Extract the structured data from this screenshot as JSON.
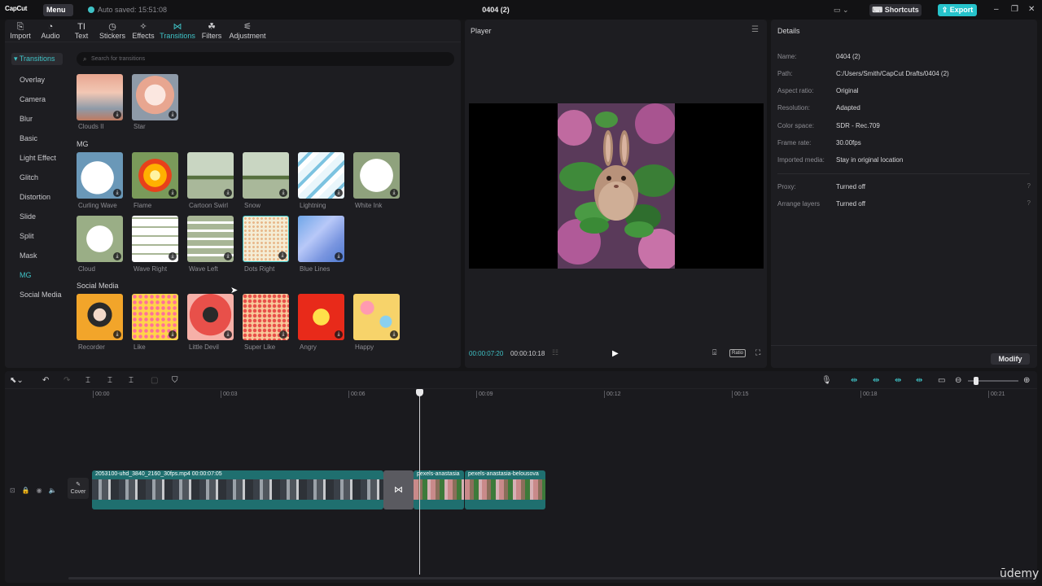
{
  "app": {
    "logo": "CapCut",
    "menu_label": "Menu",
    "autosave": "Auto saved: 15:51:08",
    "project_title": "0404 (2)",
    "shortcuts_label": "Shortcuts",
    "export_label": "Export",
    "accent_color": "#26c3cb"
  },
  "toolbar": {
    "items": [
      {
        "label": "Import",
        "icon": "import-icon"
      },
      {
        "label": "Audio",
        "icon": "audio-icon"
      },
      {
        "label": "Text",
        "icon": "text-icon"
      },
      {
        "label": "Stickers",
        "icon": "sticker-icon"
      },
      {
        "label": "Effects",
        "icon": "effects-icon"
      },
      {
        "label": "Transitions",
        "icon": "transitions-icon",
        "active": true
      },
      {
        "label": "Filters",
        "icon": "filters-icon"
      },
      {
        "label": "Adjustment",
        "icon": "adjustment-icon"
      }
    ]
  },
  "sidebar": {
    "items": [
      "Transitions",
      "Overlay",
      "Camera",
      "Blur",
      "Basic",
      "Light Effect",
      "Glitch",
      "Distortion",
      "Slide",
      "Split",
      "Mask",
      "MG",
      "Social Media"
    ],
    "selected": "Transitions"
  },
  "search": {
    "placeholder": "Search for transitions"
  },
  "transitions": {
    "top": [
      "Clouds II",
      "Star"
    ],
    "mg_title": "MG",
    "mg": [
      "Curling Wave",
      "Flame",
      "Cartoon Swirl",
      "Snow",
      "Lightning",
      "White Ink",
      "Cloud",
      "Wave Right",
      "Wave Left",
      "Dots Right",
      "Blue Lines"
    ],
    "social_title": "Social Media",
    "social": [
      "Recorder",
      "Like",
      "Little Devil",
      "Super Like",
      "Angry",
      "Happy"
    ]
  },
  "player": {
    "title": "Player",
    "current_time": "00:00:07:20",
    "duration": "00:00:10:18",
    "ratio_label": "Ratio"
  },
  "details": {
    "title": "Details",
    "rows": [
      {
        "key": "Name:",
        "value": "0404 (2)"
      },
      {
        "key": "Path:",
        "value": "C:/Users/Smith/CapCut Drafts/0404 (2)"
      },
      {
        "key": "Aspect ratio:",
        "value": "Original"
      },
      {
        "key": "Resolution:",
        "value": "Adapted"
      },
      {
        "key": "Color space:",
        "value": "SDR - Rec.709"
      },
      {
        "key": "Frame rate:",
        "value": "30.00fps"
      },
      {
        "key": "Imported media:",
        "value": "Stay in original location"
      }
    ],
    "rows2": [
      {
        "key": "Proxy:",
        "value": "Turned off"
      },
      {
        "key": "Arrange layers",
        "value": "Turned off"
      }
    ],
    "modify_label": "Modify"
  },
  "timeline": {
    "ticks": [
      "00:00",
      "00:03",
      "00:06",
      "00:09",
      "00:12",
      "00:15",
      "00:18",
      "00:21"
    ],
    "cover_label": "Cover",
    "clip1_label": "2053100-uhd_3840_2160_30fps.mp4   00:00:07:05",
    "clip2_label": "pexels-anastasia",
    "clip3_label": "pexels-anastasia-belousova"
  },
  "watermark": "ūdemy"
}
